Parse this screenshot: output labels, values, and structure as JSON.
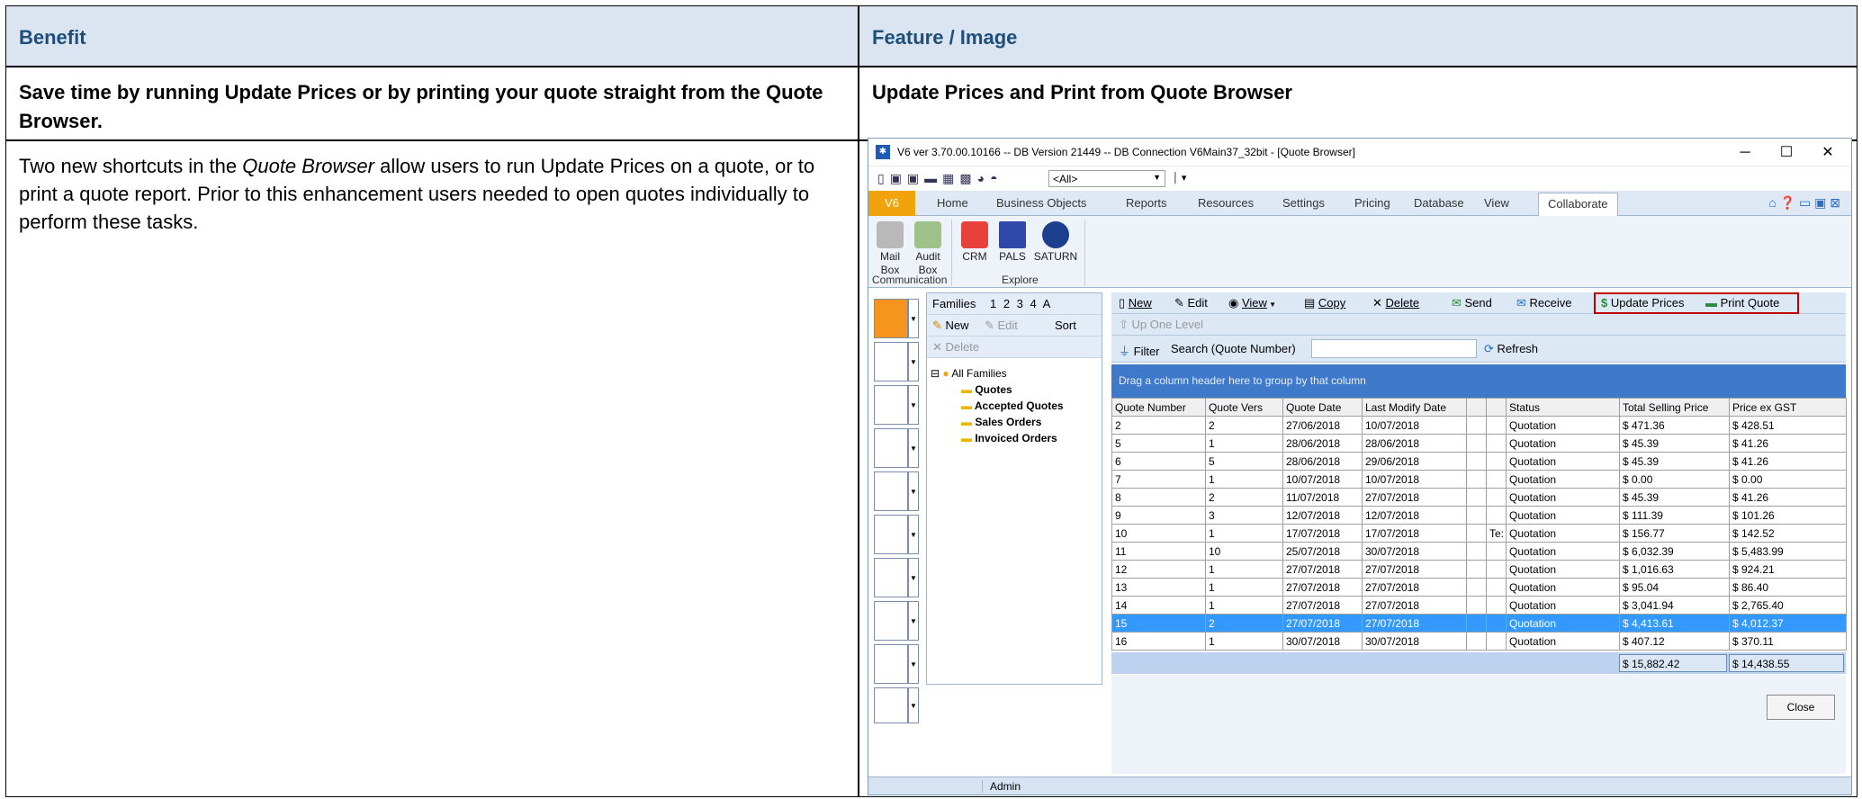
{
  "table": {
    "col1_header": "Benefit",
    "col2_header": "Feature / Image",
    "benefit_bold": "Save time by running Update Prices or by printing your quote straight from the Quote Browser.",
    "feature_bold": "Update Prices and Print from Quote Browser",
    "desc_part1": "Two new shortcuts in the ",
    "desc_italic": "Quote Browser",
    "desc_part2": " allow users to run Update Prices on a quote, or to print a quote report. Prior to this enhancement users needed to open quotes individually to perform these tasks."
  },
  "window": {
    "title": "V6 ver 3.70.00.10166 -- DB Version 21449 -- DB Connection V6Main37_32bit - [Quote Browser]",
    "qat_combo": "<All>",
    "tabs": [
      "V6",
      "Home",
      "Business Objects",
      "Reports",
      "Resources",
      "Settings",
      "Pricing",
      "Database",
      "View",
      "Collaborate"
    ],
    "ribbon_buttons": [
      "Mail Box",
      "Audit Box",
      "CRM",
      "PALS",
      "SATURN"
    ],
    "mail_l1": "Mail",
    "mail_l2": "Box",
    "audit_l1": "Audit",
    "audit_l2": "Box",
    "groups": [
      "Communication",
      "Explore"
    ],
    "status_user": "Admin"
  },
  "families": {
    "tab_label": "Families",
    "tab_nums": "1 2 3 4 A",
    "new": "New",
    "edit": "Edit",
    "sort": "Sort",
    "delete": "Delete",
    "root": "All Families",
    "items": [
      "Quotes",
      "Accepted Quotes",
      "Sales Orders",
      "Invoiced Orders"
    ]
  },
  "grid": {
    "toolbar": {
      "new": "New",
      "edit": "Edit",
      "view": "View",
      "copy": "Copy",
      "delete": "Delete",
      "send": "Send",
      "receive": "Receive",
      "update_prices": "Update Prices",
      "print_quote": "Print Quote"
    },
    "up_one_level": "Up One Level",
    "filter": "Filter",
    "search_label": "Search (Quote Number)",
    "refresh": "Refresh",
    "group_hint": "Drag a column header here to group by that column",
    "columns": [
      "Quote Number",
      "Quote Vers",
      "Quote Date",
      "Last Modify Date",
      "",
      "",
      "Status",
      "Total Selling Price",
      "Price ex GST"
    ],
    "rows": [
      [
        "2",
        "2",
        "27/06/2018",
        "10/07/2018",
        "",
        "",
        "Quotation",
        "$ 471.36",
        "$ 428.51"
      ],
      [
        "5",
        "1",
        "28/06/2018",
        "28/06/2018",
        "",
        "",
        "Quotation",
        "$ 45.39",
        "$ 41.26"
      ],
      [
        "6",
        "5",
        "28/06/2018",
        "29/06/2018",
        "",
        "",
        "Quotation",
        "$ 45.39",
        "$ 41.26"
      ],
      [
        "7",
        "1",
        "10/07/2018",
        "10/07/2018",
        "",
        "",
        "Quotation",
        "$ 0.00",
        "$ 0.00"
      ],
      [
        "8",
        "2",
        "11/07/2018",
        "27/07/2018",
        "",
        "",
        "Quotation",
        "$ 45.39",
        "$ 41.26"
      ],
      [
        "9",
        "3",
        "12/07/2018",
        "12/07/2018",
        "",
        "",
        "Quotation",
        "$ 111.39",
        "$ 101.26"
      ],
      [
        "10",
        "1",
        "17/07/2018",
        "17/07/2018",
        "",
        "Te:",
        "Quotation",
        "$ 156.77",
        "$ 142.52"
      ],
      [
        "11",
        "10",
        "25/07/2018",
        "30/07/2018",
        "",
        "",
        "Quotation",
        "$ 6,032.39",
        "$ 5,483.99"
      ],
      [
        "12",
        "1",
        "27/07/2018",
        "27/07/2018",
        "",
        "",
        "Quotation",
        "$ 1,016.63",
        "$ 924.21"
      ],
      [
        "13",
        "1",
        "27/07/2018",
        "27/07/2018",
        "",
        "",
        "Quotation",
        "$ 95.04",
        "$ 86.40"
      ],
      [
        "14",
        "1",
        "27/07/2018",
        "27/07/2018",
        "",
        "",
        "Quotation",
        "$ 3,041.94",
        "$ 2,765.40"
      ],
      [
        "15",
        "2",
        "27/07/2018",
        "27/07/2018",
        "",
        "",
        "Quotation",
        "$ 4,413.61",
        "$ 4,012.37"
      ],
      [
        "16",
        "1",
        "30/07/2018",
        "30/07/2018",
        "",
        "",
        "Quotation",
        "$ 407.12",
        "$ 370.11"
      ]
    ],
    "selected_row": 11,
    "total_selling": "$ 15,882.42",
    "total_ex_gst": "$ 14,438.55",
    "close": "Close"
  },
  "colors": {
    "header_bg": "#dbe5f1",
    "header_text": "#1f4e79",
    "selection": "#3399ff",
    "highlight_box": "#c00000"
  }
}
